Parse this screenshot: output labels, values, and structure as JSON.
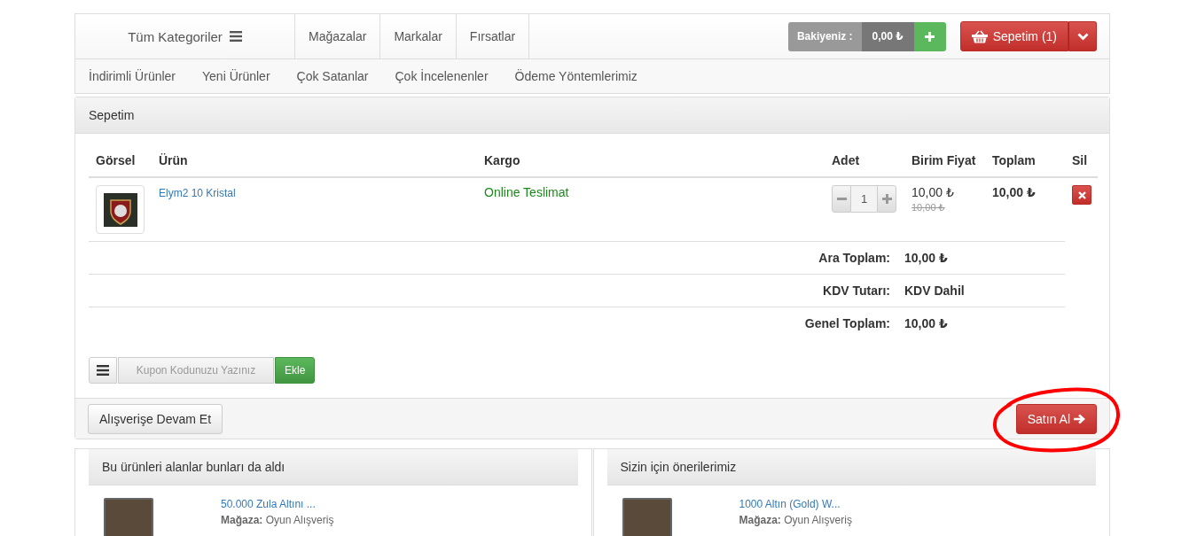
{
  "header": {
    "categories_button": "Tüm Kategoriler",
    "nav": [
      "Mağazalar",
      "Markalar",
      "Fırsatlar"
    ],
    "balance": {
      "label": "Bakiyeniz :",
      "amount": "0,00 ₺"
    },
    "cart_button": "Sepetim (1)"
  },
  "subnav": [
    "İndirimli Ürünler",
    "Yeni Ürünler",
    "Çok Satanlar",
    "Çok İncelenenler",
    "Ödeme Yöntemlerimiz"
  ],
  "cart": {
    "title": "Sepetim",
    "columns": [
      "Görsel",
      "Ürün",
      "Kargo",
      "Adet",
      "Birim Fiyat",
      "Toplam",
      "Sil"
    ],
    "rows": [
      {
        "product": "Elym2 10 Kristal",
        "shipping": "Online Teslimat",
        "quantity": "1",
        "unit_price": "10,00 ₺",
        "old_price": "10,00 ₺",
        "total": "10,00 ₺"
      }
    ],
    "summary": [
      {
        "label": "Ara Toplam:",
        "value": "10,00 ₺"
      },
      {
        "label": "KDV Tutarı:",
        "value": "KDV Dahil"
      },
      {
        "label": "Genel Toplam:",
        "value": "10,00 ₺"
      }
    ],
    "coupon": {
      "placeholder": "Kupon Kodunuzu Yazınız",
      "button": "Ekle"
    },
    "continue_button": "Alışverişe Devam Et",
    "checkout_button": "Satın Al"
  },
  "recommendations": [
    {
      "title": "Bu ürünleri alanlar bunları da aldı",
      "items": [
        {
          "name": "50.000 Zula Altını ...",
          "store_label": "Mağaza:",
          "store": "Oyun Alışveriş"
        }
      ]
    },
    {
      "title": "Sizin için önerilerimiz",
      "items": [
        {
          "name": "1000 Altın (Gold) W...",
          "store_label": "Mağaza:",
          "store": "Oyun Alışveriş"
        }
      ]
    }
  ]
}
